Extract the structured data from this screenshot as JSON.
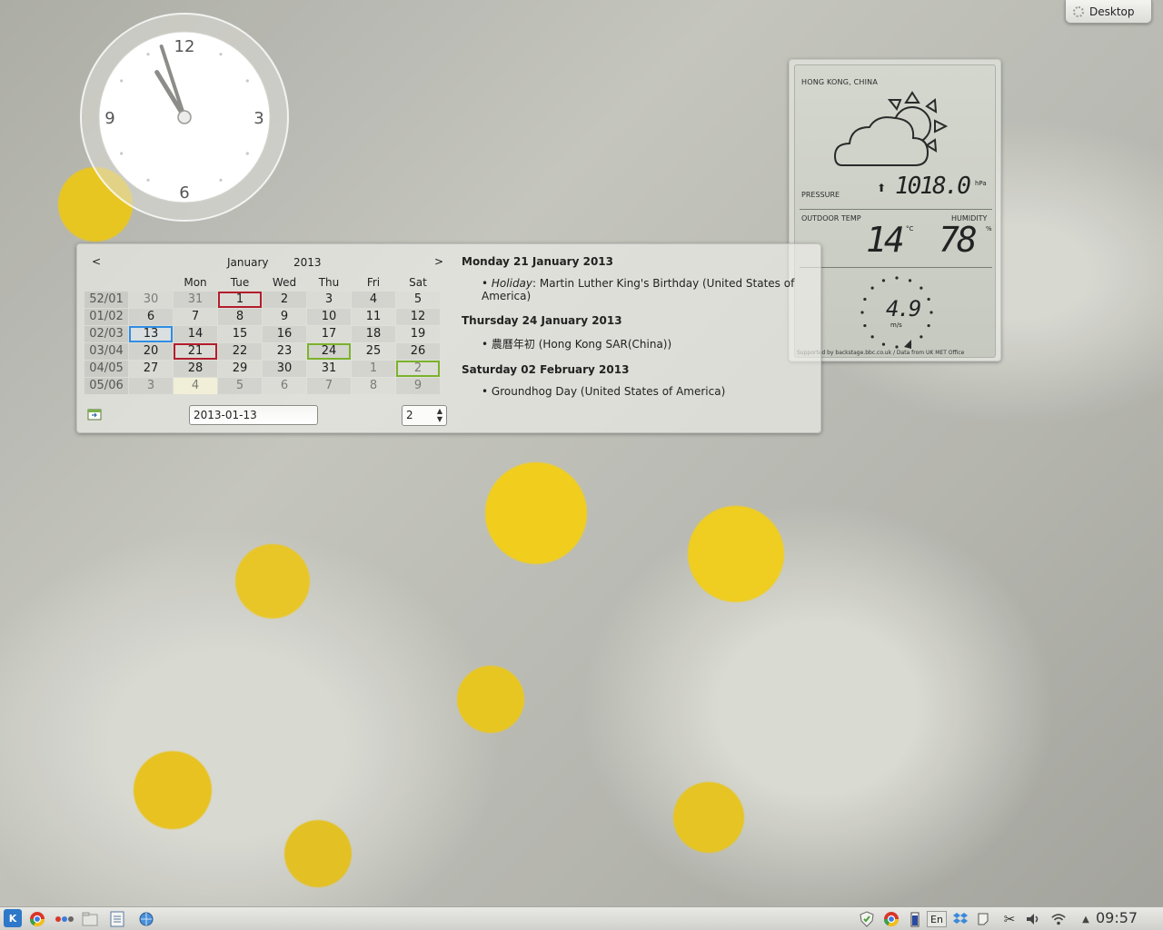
{
  "toolbox": {
    "label": "Desktop"
  },
  "clock": {
    "numbers": [
      "12",
      "3",
      "6",
      "9"
    ],
    "hour": 10,
    "minute": 57
  },
  "weather": {
    "location": "HONG KONG, CHINA",
    "pressure_label": "PRESSURE",
    "pressure_value": "1018.0",
    "pressure_unit": "hPa",
    "pressure_trend_icon": "up-arrow-icon",
    "outdoor_temp_label": "OUTDOOR TEMP",
    "temp_value": "14",
    "temp_unit": "°C",
    "humidity_label": "HUMIDITY",
    "humidity_value": "78",
    "humidity_unit": "%",
    "wind_speed": "4.9",
    "wind_unit": "m/s",
    "condition_icon": "partly-cloudy-icon",
    "credit": "Supported by backstage.bbc.co.uk / Data from UK MET Office"
  },
  "calendar": {
    "prev_label": "<",
    "next_label": ">",
    "month": "January",
    "year": "2013",
    "weekday_headers": [
      "Mon",
      "Tue",
      "Wed",
      "Thu",
      "Fri",
      "Sat"
    ],
    "weeks": [
      "52/01",
      "01/02",
      "02/03",
      "03/04",
      "04/05",
      "05/06"
    ],
    "days": [
      [
        "30",
        "31",
        "1",
        "2",
        "3",
        "4",
        "5"
      ],
      [
        "6",
        "7",
        "8",
        "9",
        "10",
        "11",
        "12"
      ],
      [
        "13",
        "14",
        "15",
        "16",
        "17",
        "18",
        "19"
      ],
      [
        "20",
        "21",
        "22",
        "23",
        "24",
        "25",
        "26"
      ],
      [
        "27",
        "28",
        "29",
        "30",
        "31",
        "1",
        "2"
      ],
      [
        "3",
        "4",
        "5",
        "6",
        "7",
        "8",
        "9"
      ]
    ],
    "date_input": "2013-01-13",
    "week_input": "2",
    "events": [
      {
        "date": "Monday 21 January 2013",
        "items": [
          {
            "prefix": "Holiday",
            "text": ": Martin Luther King's Birthday (United States of America)"
          }
        ]
      },
      {
        "date": "Thursday 24 January 2013",
        "items": [
          {
            "prefix": "",
            "text": "農曆年初 (Hong Kong SAR(China))"
          }
        ]
      },
      {
        "date": "Saturday 02 February 2013",
        "items": [
          {
            "prefix": "",
            "text": "Groundhog Day (United States of America)"
          }
        ]
      }
    ]
  },
  "panel": {
    "time": "09:57",
    "keyboard_layout": "En",
    "launcher_icon": "kde-menu-icon",
    "taskbar_icons": [
      "kickoff-icon",
      "chrome-icon",
      "activities-icon",
      "folder-icon",
      "notes-icon",
      "network-globe-icon"
    ],
    "tray_icons": [
      "shield-icon",
      "chrome-icon",
      "battery-icon",
      "keyboard-icon",
      "dropbox-icon",
      "notifications-icon",
      "scissors-icon",
      "volume-icon",
      "wifi-icon",
      "expand-arrow-icon"
    ]
  }
}
